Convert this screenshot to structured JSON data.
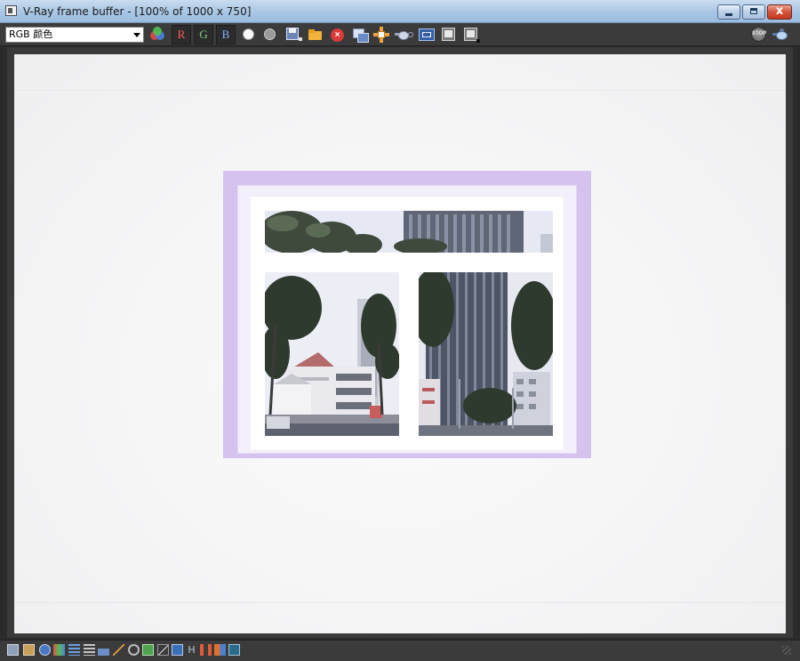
{
  "window": {
    "title": "V-Ray frame buffer - [100% of 1000 x 750]",
    "close_glyph": "x"
  },
  "toolbar": {
    "channel_select_value": "RGB 颜色",
    "red_channel_label": "R",
    "green_channel_label": "G",
    "blue_channel_label": "B",
    "icons": [
      "color-correction-icon",
      "red-channel-toggle",
      "green-channel-toggle",
      "blue-channel-toggle",
      "white-circle-icon",
      "grey-circle-icon",
      "save-image-icon",
      "open-image-icon",
      "clear-image-icon",
      "duplicate-to-max-icon",
      "track-mouse-icon",
      "render-last-icon",
      "region-render-icon",
      "compare-a-icon",
      "compare-b-icon",
      "stop-render-icon",
      "render-teapot-icon"
    ],
    "stop_label": "STOP"
  },
  "render_view": {
    "description_icon": "interior-window-render",
    "accent_frame_color": "#d5c2ef",
    "wall_color": "#f4f4f5"
  },
  "statusbar": {
    "icons": [
      "vfb-history-icon",
      "color-corrections-icon",
      "info-icon",
      "lut-icon",
      "levels-icon",
      "curves-icon",
      "exposure-icon",
      "background-icon",
      "lens-effects-icon",
      "stamp-icon",
      "compare-icon",
      "test-resolution-icon",
      "histogram-icon",
      "follow-mouse-icon",
      "abc-split-icon",
      "ocio-icon",
      "resize-grip-icon"
    ],
    "h_label": "H"
  }
}
